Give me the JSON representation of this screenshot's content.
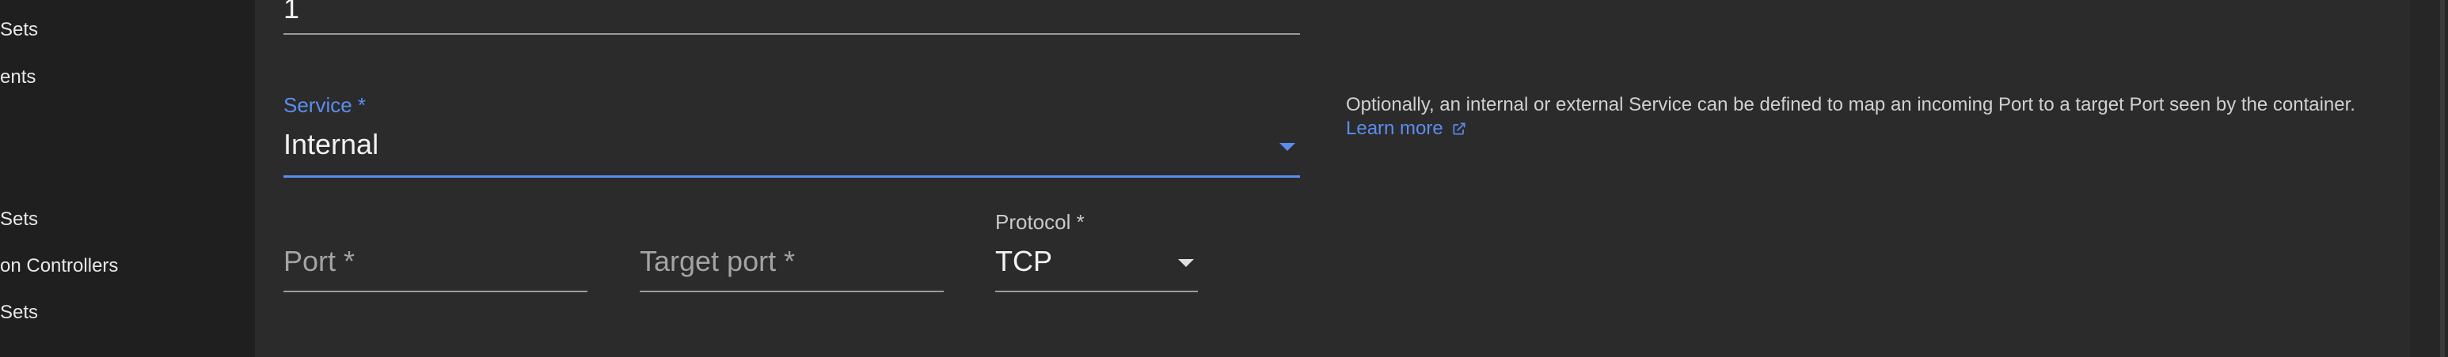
{
  "sidebar": {
    "items": [
      {
        "label": "Sets"
      },
      {
        "label": "ents"
      },
      {
        "label": "Sets"
      },
      {
        "label": "on Controllers"
      },
      {
        "label": "Sets"
      }
    ]
  },
  "form": {
    "replicas": {
      "value": "1"
    },
    "service": {
      "label": "Service *",
      "value": "Internal",
      "help_text": "Optionally, an internal or external Service can be defined to map an incoming Port to a target Port seen by the container.",
      "learn_more": "Learn more"
    },
    "port": {
      "placeholder": "Port *"
    },
    "target_port": {
      "placeholder": "Target port *"
    },
    "protocol": {
      "label": "Protocol *",
      "value": "TCP"
    }
  },
  "colors": {
    "accent": "#5b8def",
    "background": "#2b2b2b",
    "sidebar": "#1f1f1f"
  }
}
